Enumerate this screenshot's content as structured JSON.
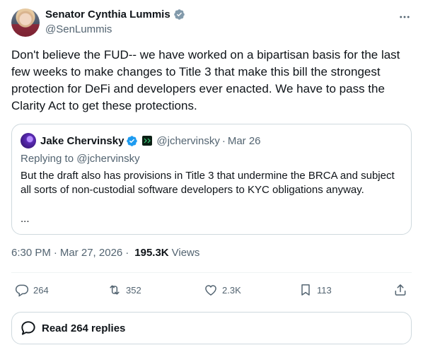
{
  "author": {
    "name": "Senator Cynthia Lummis",
    "handle": "@SenLummis",
    "verified_color": "#829aab"
  },
  "tweet": {
    "text": "Don't believe the FUD-- we have worked on a bipartisan basis for the last few weeks to make changes to Title 3 that make this bill the strongest protection for DeFi and developers ever enacted. We have to pass the Clarity Act to get these protections."
  },
  "quote": {
    "name": "Jake Chervinsky",
    "handle": "@jchervinsky",
    "separator": "·",
    "date": "Mar 26",
    "reply_to": "Replying to @jchervinsky",
    "text": "But the draft also has provisions in Title 3 that undermine the BRCA and subject all sorts of non-custodial software developers to KYC obligations anyway.",
    "ellipsis": "...",
    "verified_color": "#1d9bf0"
  },
  "meta": {
    "time": "6:30 PM",
    "separator": "·",
    "date": "Mar 27, 2026",
    "views_count": "195.3K",
    "views_label": "Views"
  },
  "actions": {
    "replies": "264",
    "reposts": "352",
    "likes": "2.3K",
    "bookmarks": "113"
  },
  "read_replies": {
    "label": "Read 264 replies"
  },
  "icons": [
    "verified-badge-icon",
    "more-icon",
    "reply-icon",
    "repost-icon",
    "like-icon",
    "bookmark-icon",
    "share-icon",
    "chat-bubble-icon"
  ]
}
